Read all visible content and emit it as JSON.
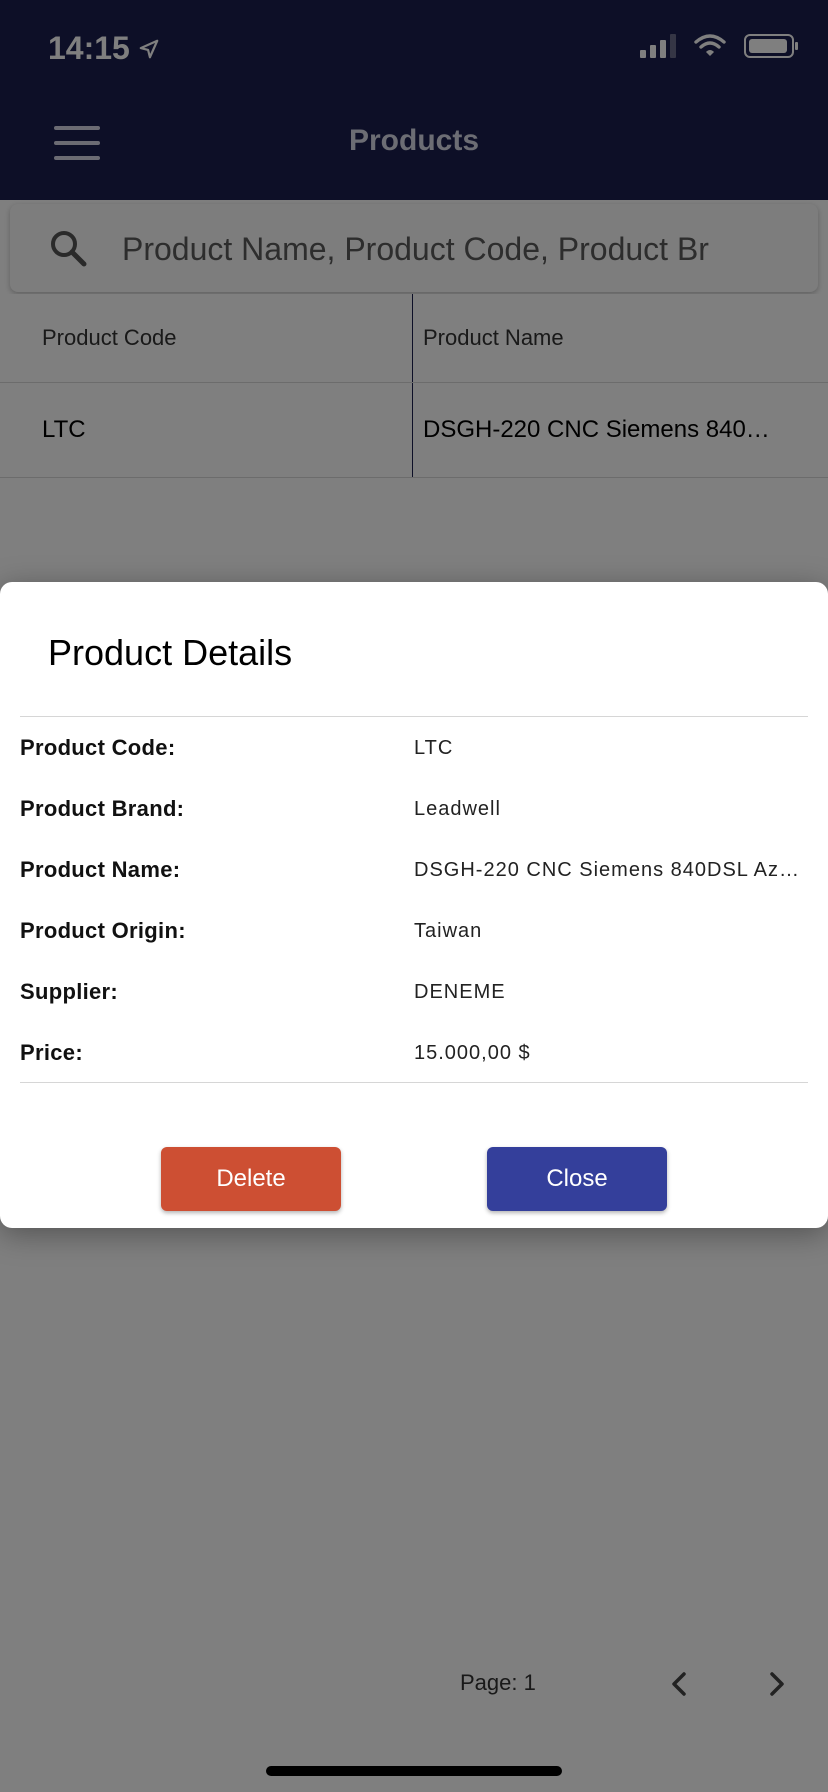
{
  "status_bar": {
    "time": "14:15"
  },
  "header": {
    "title": "Products"
  },
  "search": {
    "placeholder": "Product Name, Product Code, Product Br"
  },
  "table": {
    "columns": [
      "Product Code",
      "Product Name"
    ],
    "rows": [
      [
        "LTC",
        "DSGH-220 CNC Siemens 840…"
      ]
    ]
  },
  "pagination": {
    "label": "Page: 1"
  },
  "modal": {
    "title": "Product Details",
    "fields": [
      {
        "label": "Product Code:",
        "value": "LTC"
      },
      {
        "label": "Product Brand:",
        "value": "Leadwell"
      },
      {
        "label": "Product Name:",
        "value": "DSGH-220 CNC Siemens 840DSL Az…"
      },
      {
        "label": "Product Origin:",
        "value": "Taiwan"
      },
      {
        "label": "Supplier:",
        "value": "DENEME"
      },
      {
        "label": "Price:",
        "value": "15.000,00 $"
      }
    ],
    "delete_label": "Delete",
    "close_label": "Close"
  },
  "colors": {
    "header_bg": "#1b1f4e",
    "delete_button": "#cd4f33",
    "close_button": "#343f9b"
  },
  "icons": [
    "location-arrow-icon",
    "signal-icon",
    "wifi-icon",
    "battery-icon",
    "menu-icon",
    "search-icon",
    "chevron-left-icon",
    "chevron-right-icon"
  ]
}
